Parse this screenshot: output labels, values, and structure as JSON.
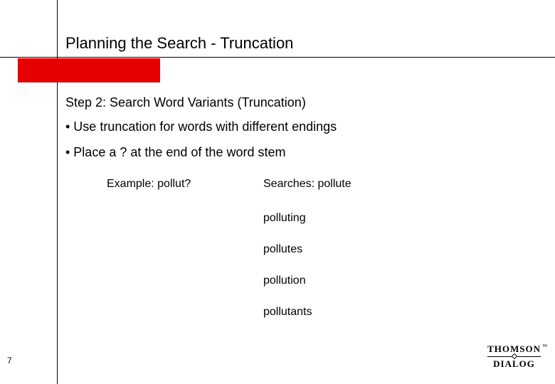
{
  "title": "Planning the Search - Truncation",
  "subtitle": "Step 2:  Search Word Variants  (Truncation)",
  "bullets": [
    "•  Use truncation for words with different endings",
    "•  Place a ? at the end of the word stem"
  ],
  "example_label": "Example:  pollut?",
  "searches_label": "Searches:  pollute",
  "results": [
    "polluting",
    "pollutes",
    "pollution",
    "pollutants"
  ],
  "page_number": "7",
  "logo": {
    "top": "THOMSON",
    "bottom": "DIALOG"
  }
}
